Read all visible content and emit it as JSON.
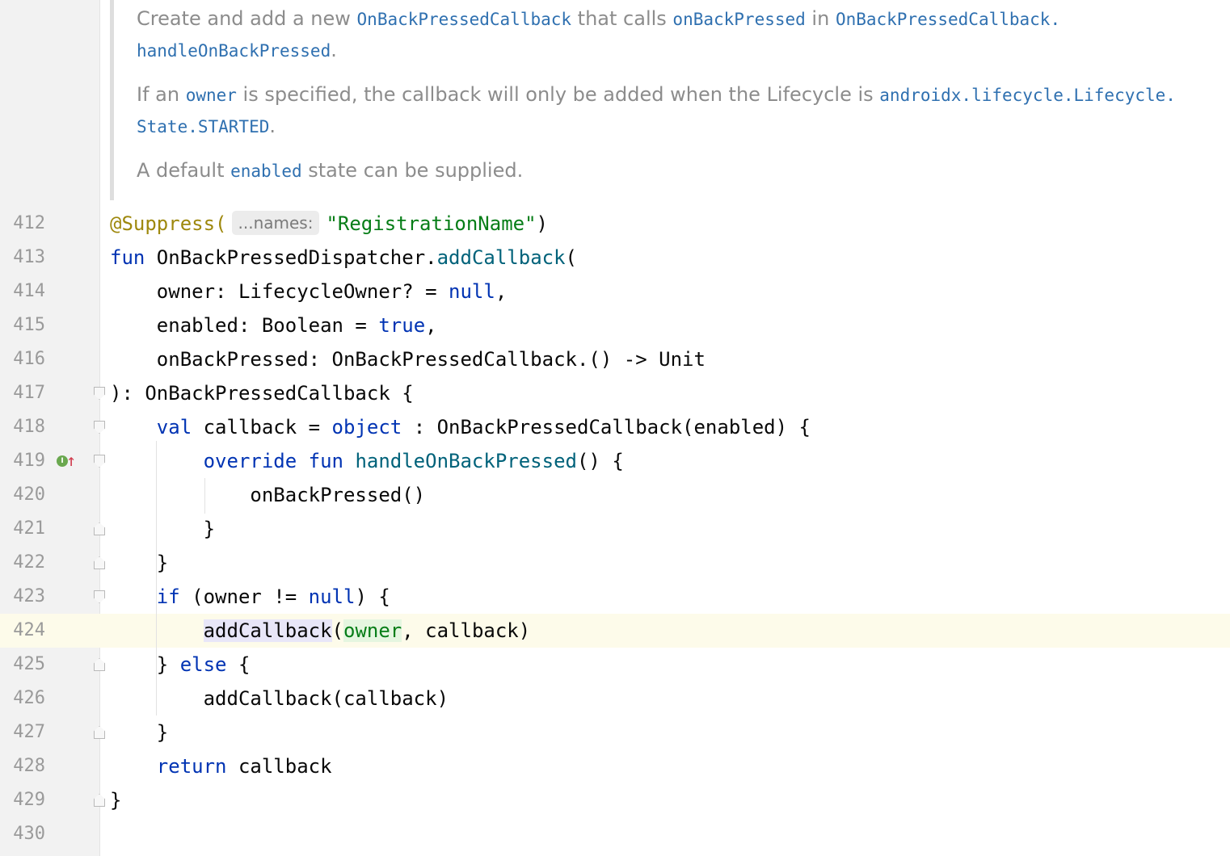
{
  "doc": {
    "p1": [
      {
        "t": "Create and add a new ",
        "c": false
      },
      {
        "t": "OnBackPressedCallback",
        "c": true
      },
      {
        "t": " that calls ",
        "c": false
      },
      {
        "t": "onBackPressed",
        "c": true
      },
      {
        "t": " in ",
        "c": false
      },
      {
        "t": "OnBackPressedCallback.",
        "c": true
      }
    ],
    "p1b": [
      {
        "t": "handleOnBackPressed",
        "c": true
      },
      {
        "t": ".",
        "c": false
      }
    ],
    "p2": [
      {
        "t": "If an ",
        "c": false
      },
      {
        "t": "owner",
        "c": true
      },
      {
        "t": " is specified, the callback will only be added when the Lifecycle is ",
        "c": false
      },
      {
        "t": "androidx.lifecycle.Lifecycle.",
        "c": true
      }
    ],
    "p2b": [
      {
        "t": "State.STARTED",
        "c": true
      },
      {
        "t": ".",
        "c": false
      }
    ],
    "p3": [
      {
        "t": "A default ",
        "c": false
      },
      {
        "t": "enabled",
        "c": true
      },
      {
        "t": " state can be supplied.",
        "c": false
      }
    ]
  },
  "inlay_hint": "...names:",
  "current_line": "424",
  "lines": [
    {
      "n": "412",
      "segs": [
        {
          "t": "@Suppress(",
          "k": "ann"
        },
        {
          "hint": true
        },
        {
          "t": "\"RegistrationName\"",
          "k": "str"
        },
        {
          "t": ")",
          "k": ""
        }
      ]
    },
    {
      "n": "413",
      "segs": [
        {
          "t": "fun",
          "k": "kw"
        },
        {
          "t": " OnBackPressedDispatcher.",
          "k": ""
        },
        {
          "t": "addCallback",
          "k": "fn"
        },
        {
          "t": "(",
          "k": ""
        }
      ]
    },
    {
      "n": "414",
      "segs": [
        {
          "t": "    owner: LifecycleOwner? = ",
          "k": ""
        },
        {
          "t": "null",
          "k": "kw"
        },
        {
          "t": ",",
          "k": ""
        }
      ]
    },
    {
      "n": "415",
      "segs": [
        {
          "t": "    enabled: Boolean = ",
          "k": ""
        },
        {
          "t": "true",
          "k": "kw"
        },
        {
          "t": ",",
          "k": ""
        }
      ]
    },
    {
      "n": "416",
      "segs": [
        {
          "t": "    onBackPressed: OnBackPressedCallback.() -> Unit",
          "k": ""
        }
      ]
    },
    {
      "n": "417",
      "segs": [
        {
          "t": "): OnBackPressedCallback {",
          "k": ""
        }
      ],
      "fold": "open"
    },
    {
      "n": "418",
      "segs": [
        {
          "t": "    ",
          "k": ""
        },
        {
          "t": "val",
          "k": "kw"
        },
        {
          "t": " callback = ",
          "k": ""
        },
        {
          "t": "object",
          "k": "kw"
        },
        {
          "t": " : OnBackPressedCallback(enabled) {",
          "k": ""
        }
      ],
      "fold": "open"
    },
    {
      "n": "419",
      "segs": [
        {
          "t": "        ",
          "k": ""
        },
        {
          "t": "override fun",
          "k": "kw"
        },
        {
          "t": " ",
          "k": ""
        },
        {
          "t": "handleOnBackPressed",
          "k": "fn"
        },
        {
          "t": "() {",
          "k": ""
        }
      ],
      "fold": "open"
    },
    {
      "n": "420",
      "segs": [
        {
          "t": "            onBackPressed()",
          "k": ""
        }
      ]
    },
    {
      "n": "421",
      "segs": [
        {
          "t": "        }",
          "k": ""
        }
      ],
      "fold": "close"
    },
    {
      "n": "422",
      "segs": [
        {
          "t": "    }",
          "k": ""
        }
      ],
      "fold": "close"
    },
    {
      "n": "423",
      "segs": [
        {
          "t": "    ",
          "k": ""
        },
        {
          "t": "if",
          "k": "kw"
        },
        {
          "t": " (owner != ",
          "k": ""
        },
        {
          "t": "null",
          "k": "kw"
        },
        {
          "t": ") {",
          "k": ""
        }
      ],
      "fold": "open"
    },
    {
      "n": "424",
      "segs": [
        {
          "t": "        ",
          "k": ""
        },
        {
          "caret": true
        },
        {
          "t": "addCallback",
          "k": "usage"
        },
        {
          "t": "(",
          "k": ""
        },
        {
          "t": "owner",
          "k": "param"
        },
        {
          "t": ", callback)",
          "k": ""
        }
      ]
    },
    {
      "n": "425",
      "segs": [
        {
          "t": "    } ",
          "k": ""
        },
        {
          "t": "else",
          "k": "kw"
        },
        {
          "t": " {",
          "k": ""
        }
      ],
      "fold": "close"
    },
    {
      "n": "426",
      "segs": [
        {
          "t": "        addCallback(callback)",
          "k": ""
        }
      ]
    },
    {
      "n": "427",
      "segs": [
        {
          "t": "    }",
          "k": ""
        }
      ],
      "fold": "close"
    },
    {
      "n": "428",
      "segs": [
        {
          "t": "    ",
          "k": ""
        },
        {
          "t": "return",
          "k": "kw"
        },
        {
          "t": " callback",
          "k": ""
        }
      ]
    },
    {
      "n": "429",
      "segs": [
        {
          "t": "}",
          "k": ""
        }
      ],
      "fold": "close"
    },
    {
      "n": "430",
      "segs": []
    }
  ],
  "gutter_icons": {
    "line_419": [
      "implements-icon",
      "overrides-up-arrow-icon"
    ],
    "implements_letter": "I",
    "arrow_glyph": "↑"
  }
}
